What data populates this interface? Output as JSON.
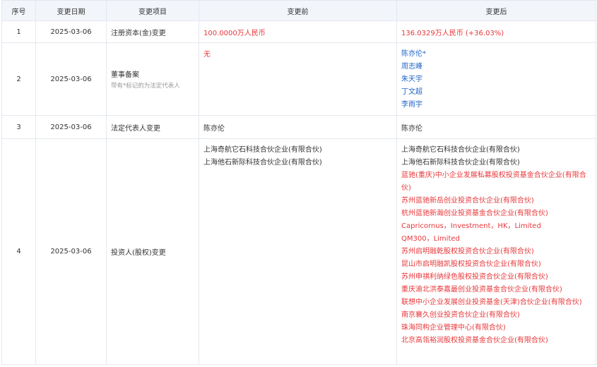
{
  "headers": [
    "序号",
    "变更日期",
    "变更项目",
    "变更前",
    "变更后"
  ],
  "rows": [
    {
      "no": "1",
      "date": "2025-03-06",
      "item": "注册资本(金)变更",
      "before": "100.0000万人民币",
      "after": "136.0329万人民币 (+36.03%)"
    },
    {
      "no": "2",
      "date": "2025-03-06",
      "item": "董事备案",
      "item_note": "带有*标记的为法定代表人",
      "before": "无",
      "after": [
        "陈亦伦*",
        "周志峰",
        "朱天宇",
        "丁文超",
        "李雨宇"
      ]
    },
    {
      "no": "3",
      "date": "2025-03-06",
      "item": "法定代表人变更",
      "before": "陈亦伦",
      "after": "陈亦伦"
    },
    {
      "no": "4",
      "date": "2025-03-06",
      "item": "投资人(股权)变更",
      "before": [
        "上海奇航它石科技合伙企业(有限合伙)",
        "上海他石新际科技合伙企业(有限合伙)"
      ],
      "after_unchanged": [
        "上海奇航它石科技合伙企业(有限合伙)",
        "上海他石新际科技合伙企业(有限合伙)"
      ],
      "after_added": [
        "蓝驰(重庆)中小企业发展私募股权投资基金合伙企业(有限合伙)",
        "苏州蓝驰新岳创业投资合伙企业(有限合伙)",
        "杭州蓝驰新瀚创业投资基金合伙企业(有限合伙)",
        "Capricornus，Investment，HK，Limited",
        "QM300，Limited",
        "苏州启明融乾股权投资合伙企业(有限合伙)",
        "昆山市启明融凯股权投资合伙企业(有限合伙)",
        "苏州申祺利纳绿色股权投资合伙企业(有限合伙)",
        "重庆渝北洪泰嘉最创业投资基金合伙企业(有限合伙)",
        "联想中小企业发展创业投资基金(天津)合伙企业(有限合伙)",
        "南京襄久创业投资合伙企业(有限合伙)",
        "珠海同构企业管理中心(有限合伙)",
        "北京高瓴裕润股权投资基金合伙企业(有限合伙)"
      ]
    }
  ],
  "colors": {
    "header_bg": "#f2f5fa",
    "border": "#e4e8ef",
    "added": "#e8373a",
    "link": "#1f64c9"
  }
}
